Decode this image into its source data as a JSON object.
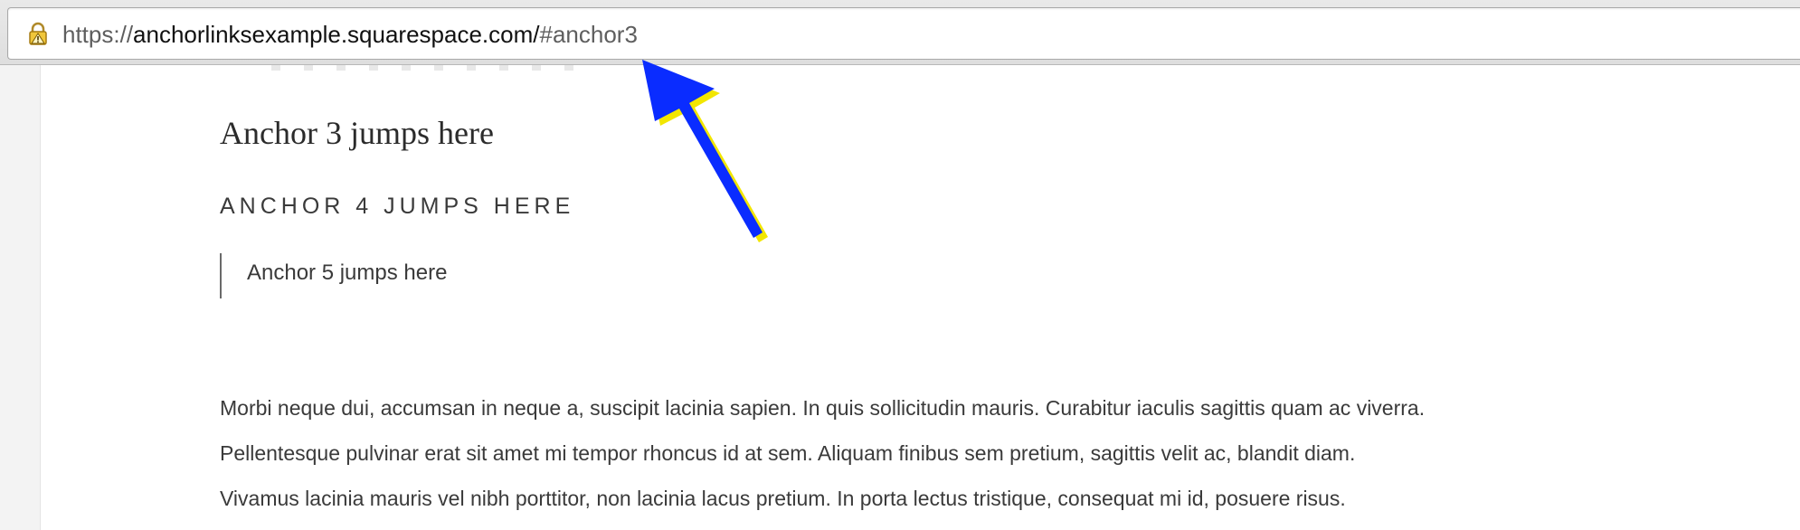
{
  "browser": {
    "address_bar": {
      "scheme": "https://",
      "domain": "anchorlinksexample.squarespace.com/",
      "hash": "#anchor3",
      "lock_icon": "warning-lock-icon"
    }
  },
  "content": {
    "heading_serif": "Anchor 3 jumps here",
    "heading_caps": "ANCHOR 4 JUMPS HERE",
    "blockquote": "Anchor 5 jumps here",
    "paragraph_lines": [
      "Morbi neque dui, accumsan in neque a, suscipit lacinia sapien. In quis sollicitudin mauris. Curabitur iaculis sagittis quam ac viverra.",
      "Pellentesque pulvinar erat sit amet mi tempor rhoncus id at sem. Aliquam finibus sem pretium, sagittis velit ac, blandit diam.",
      "Vivamus lacinia mauris vel nibh porttitor, non lacinia lacus pretium. In porta lectus tristique, consequat mi id, posuere risus."
    ]
  },
  "annotation": {
    "arrow_color": "#0a2cff",
    "arrow_shadow_color": "#f2e600"
  }
}
